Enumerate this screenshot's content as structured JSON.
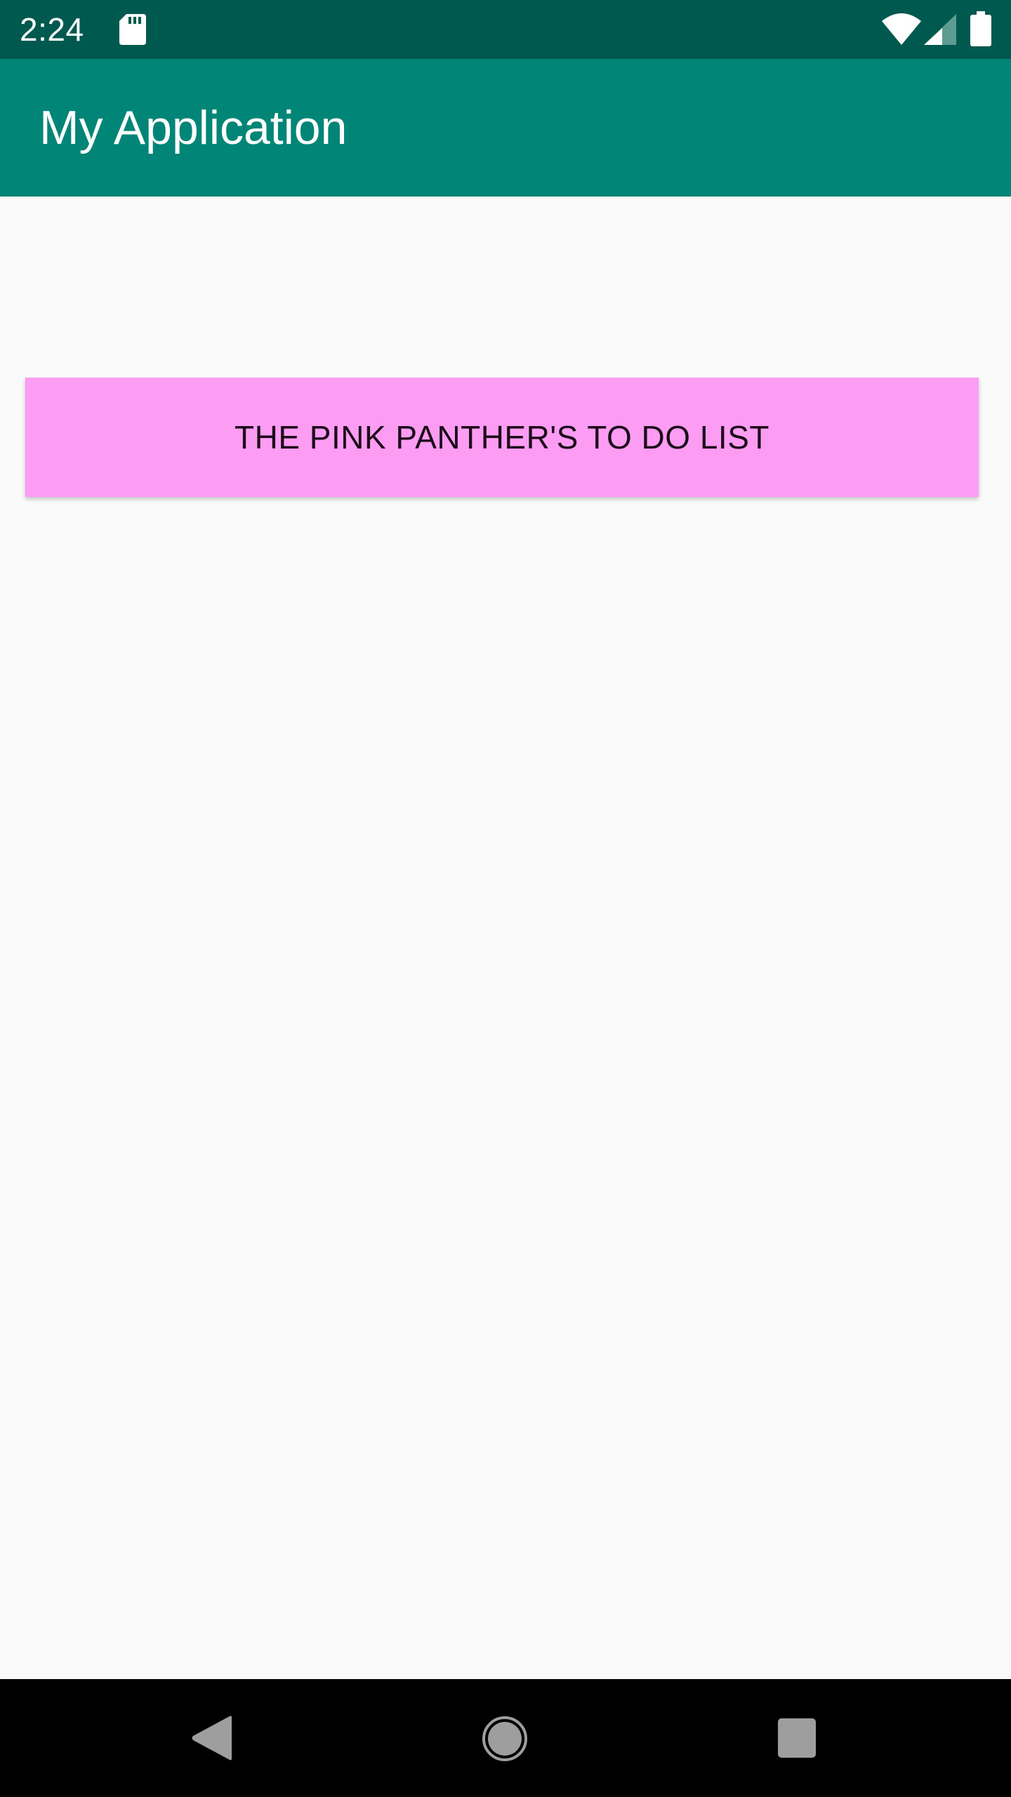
{
  "status_bar": {
    "time": "2:24",
    "icons": [
      "sd-card-icon",
      "wifi-icon",
      "cell-signal-icon",
      "battery-icon"
    ]
  },
  "app_bar": {
    "title": "My Application"
  },
  "main": {
    "todo_button_label": "THE PINK PANTHER'S TO DO LIST"
  },
  "nav_bar": {
    "icons": [
      "back-icon",
      "home-icon",
      "recents-icon"
    ]
  },
  "colors": {
    "status_bar": "#00594e",
    "app_bar": "#008576",
    "button": "#fc9df3",
    "background": "#fafafa",
    "nav_bar": "#000000"
  }
}
